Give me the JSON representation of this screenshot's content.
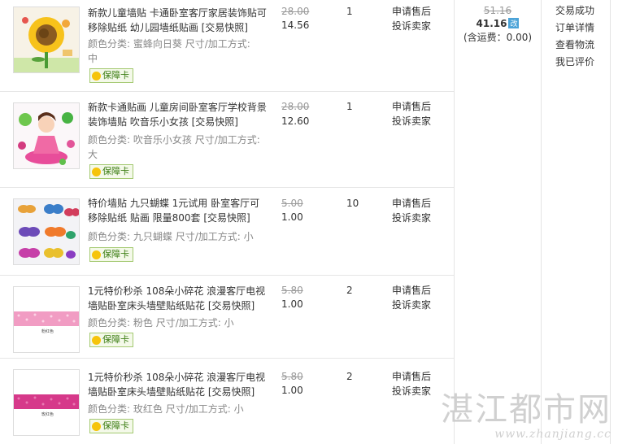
{
  "items": [
    {
      "title": "新款儿童墙贴 卡通卧室客厅家居装饰贴可移除贴纸 幼儿园墙纸贴画 [交易快照]",
      "category_label": "颜色分类:",
      "category_value": "蜜蜂向日葵",
      "size_label": "尺寸/加工方式:",
      "size_value": "中",
      "badge": "保障卡",
      "price_old": "28.00",
      "price_new": "14.56",
      "qty": "1",
      "action1": "申请售后",
      "action2": "投诉卖家"
    },
    {
      "title": "新款卡通贴画 儿童房间卧室客厅学校背景装饰墙贴 吹音乐小女孩 [交易快照]",
      "category_label": "颜色分类:",
      "category_value": "吹音乐小女孩",
      "size_label": "尺寸/加工方式:",
      "size_value": "大",
      "badge": "保障卡",
      "price_old": "28.00",
      "price_new": "12.60",
      "qty": "1",
      "action1": "申请售后",
      "action2": "投诉卖家"
    },
    {
      "title": "特价墙贴 九只蝴蝶 1元试用 卧室客厅可移除贴纸 贴画 限量800套 [交易快照]",
      "category_label": "颜色分类:",
      "category_value": "九只蝴蝶",
      "size_label": "尺寸/加工方式:",
      "size_value": "小",
      "badge": "保障卡",
      "price_old": "5.00",
      "price_new": "1.00",
      "qty": "10",
      "action1": "申请售后",
      "action2": "投诉卖家"
    },
    {
      "title": "1元特价秒杀 108朵小碎花 浪漫客厅电视墙贴卧室床头墙壁贴纸贴花 [交易快照]",
      "category_label": "颜色分类:",
      "category_value": "粉色",
      "size_label": "尺寸/加工方式:",
      "size_value": "小",
      "badge": "保障卡",
      "price_old": "5.80",
      "price_new": "1.00",
      "qty": "2",
      "action1": "申请售后",
      "action2": "投诉卖家",
      "thumb_caption": "粉红色"
    },
    {
      "title": "1元特价秒杀 108朵小碎花 浪漫客厅电视墙贴卧室床头墙壁贴纸贴花 [交易快照]",
      "category_label": "颜色分类:",
      "category_value": "玫红色",
      "size_label": "尺寸/加工方式:",
      "size_value": "小",
      "badge": "保障卡",
      "price_old": "5.80",
      "price_new": "1.00",
      "qty": "2",
      "action1": "申请售后",
      "action2": "投诉卖家",
      "thumb_caption": "玫红色"
    }
  ],
  "payment": {
    "old_total": "51.16",
    "total": "41.16",
    "mobile_tag": "改",
    "shipping_note": "(含运费：0.00)"
  },
  "status": {
    "state": "交易成功",
    "links": [
      "订单详情",
      "查看物流",
      "我已评价"
    ]
  },
  "watermark": {
    "text": "湛江都市网",
    "url": "www.zhanjiang.cc"
  },
  "colors": {
    "border": "#e4e4e4",
    "badge_green": "#3b7d12",
    "strike_gray": "#999999",
    "mobile_blue": "#4ba3d8"
  }
}
